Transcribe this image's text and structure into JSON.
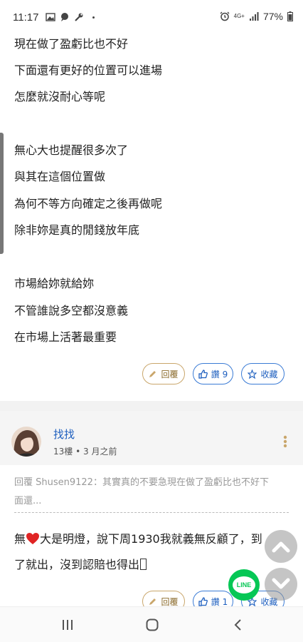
{
  "status_bar": {
    "time": "11:17",
    "network": "4G+",
    "battery": "77%"
  },
  "post": {
    "lines": [
      "現在做了盈虧比也不好",
      "下面還有更好的位置可以進場",
      "怎麼就沒耐心等呢",
      "無心大也提醒很多次了",
      "與其在這個位置做",
      "為何不等方向確定之後再做呢",
      "除非妳是真的閒錢放年底",
      "市場給妳就給妳",
      "不管誰說多空都沒意義",
      "在市場上活著最重要"
    ],
    "actions": {
      "reply_label": "回覆",
      "like_label": "讚 9",
      "favorite_label": "收藏"
    }
  },
  "comment": {
    "author": "找找",
    "floor": "13樓",
    "time_ago": "3 月之前",
    "quote_line1": "回覆 Shusen9122：其實真的不要急現在做了盈虧比也不好下",
    "quote_line2": "面還...",
    "text_line1_before_heart": "無",
    "text_line1_after_heart": "大是明燈，說下周1930我就義無反顧了，到",
    "text_line2": "了就出，沒到認賠也得出",
    "actions": {
      "reply_label": "回覆",
      "like_label": "讚 1",
      "favorite_label": "收藏"
    }
  },
  "floating": {
    "line_label": "LINE"
  },
  "colors": {
    "link_blue": "#1e5fbf",
    "reply_gold": "#c9a66b",
    "line_green": "#06c755",
    "heart_red": "#e02424"
  }
}
